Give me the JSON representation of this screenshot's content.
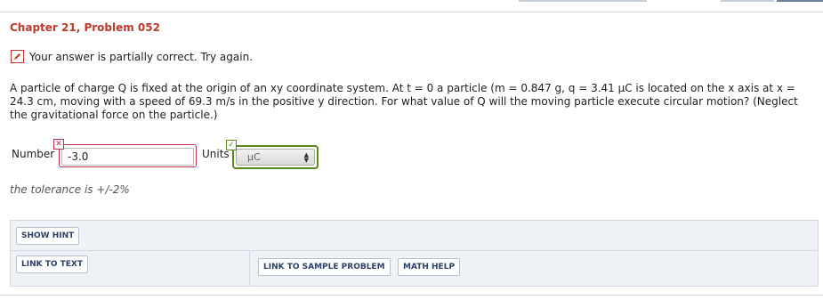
{
  "header": {
    "title": "Chapter 21, Problem 052"
  },
  "feedback": {
    "icon": "pencil-icon",
    "message": "Your answer is partially correct.  Try again."
  },
  "problem": {
    "text": "A particle of charge Q is fixed at the origin of an xy coordinate system. At t = 0 a particle (m = 0.847 g, q = 3.41 μC is located on the x axis at x = 24.3 cm, moving with a speed of 69.3 m/s in the positive y direction. For what value of Q will the moving particle execute circular motion? (Neglect the gravitational force on the particle.)"
  },
  "answer": {
    "number_label": "Number",
    "number_value": "-3.0",
    "number_status_icon": "x-icon",
    "number_status_color": "#c0304a",
    "units_label": "Units",
    "units_value": "μC",
    "units_status_icon": "check-icon",
    "units_status_color": "#5a8a1a"
  },
  "tolerance": "the tolerance is +/-2%",
  "actions": {
    "show_hint": "SHOW HINT",
    "link_to_text": "LINK TO TEXT",
    "link_to_sample": "LINK TO SAMPLE PROBLEM",
    "math_help": "MATH HELP"
  }
}
